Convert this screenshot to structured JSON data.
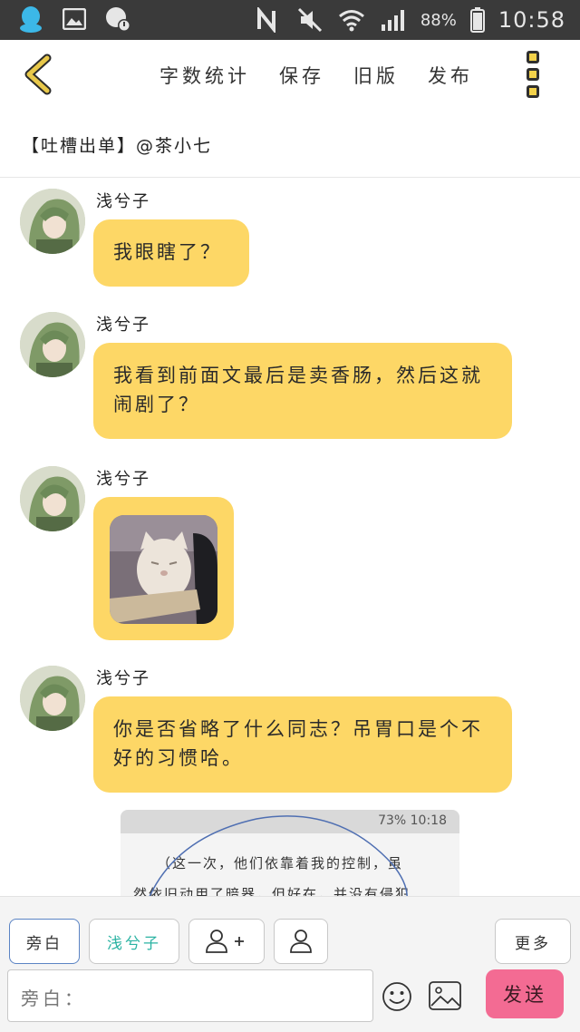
{
  "status_bar": {
    "battery_text": "88%",
    "time": "10:58"
  },
  "toolbar": {
    "actions": [
      "字数统计",
      "保存",
      "旧版",
      "发布"
    ]
  },
  "article": {
    "title": "【吐槽出单】@茶小七"
  },
  "messages": [
    {
      "sender": "浅兮子",
      "text": "我眼瞎了？"
    },
    {
      "sender": "浅兮子",
      "text": "我看到前面文最后是卖香肠，然后这就闹剧了？"
    },
    {
      "sender": "浅兮子",
      "image": "cat-sticker"
    },
    {
      "sender": "浅兮子",
      "text": "你是否省略了什么同志？吊胃口是个不好的习惯哈。"
    }
  ],
  "preview": {
    "status_text": "73% 10:18",
    "line1": "（这一次，他们依靠着我的控制，虽",
    "line2": "然依旧动用了暗器，但好在，并没有侵犯"
  },
  "bottom": {
    "chips": [
      "旁白",
      "浅兮子"
    ],
    "more_label": "更多",
    "input_label": "旁白：",
    "input_value": "",
    "send_label": "发送"
  },
  "colors": {
    "bubble": "#fdd766",
    "accent_back": "#e8c84a",
    "send": "#f36b93",
    "teal_chip": "#2bb3a3"
  }
}
